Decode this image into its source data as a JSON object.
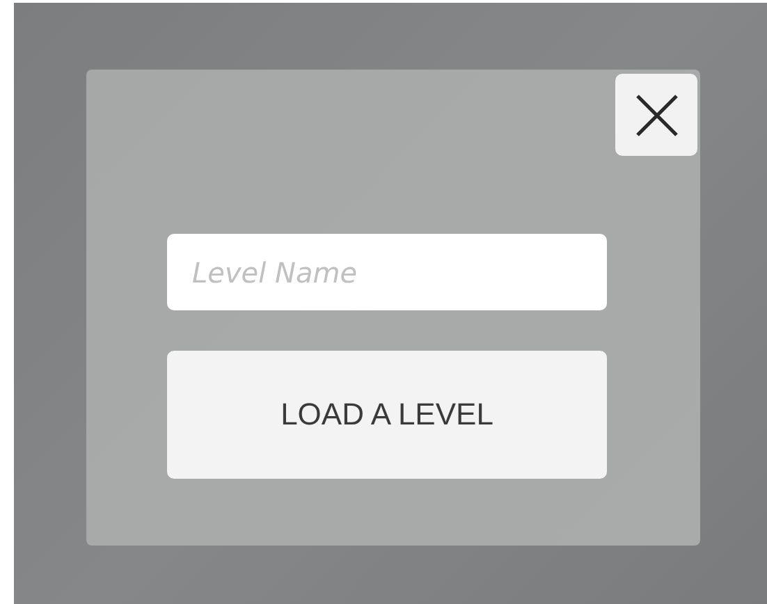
{
  "dialog": {
    "level_name_field": {
      "placeholder": "Level Name"
    },
    "load_button": {
      "label": "LOAD A LEVEL"
    }
  }
}
